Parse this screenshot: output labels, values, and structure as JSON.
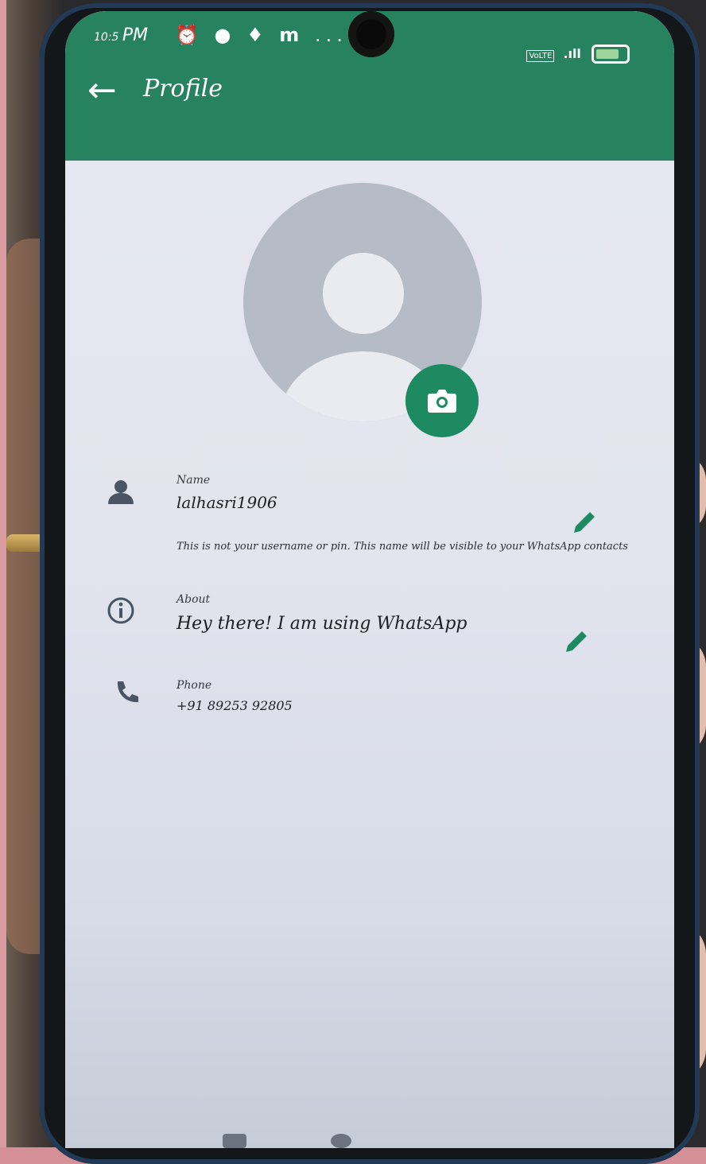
{
  "status_bar": {
    "time_small": "10:5",
    "time_large": "PM",
    "icons": [
      "alarm-icon",
      "chat-icon",
      "swiggy-icon",
      "m-icon",
      "more-dots"
    ],
    "more": "...",
    "network": "VoLTE",
    "signal": ".ıll"
  },
  "app_bar": {
    "title": "Profile"
  },
  "profile": {
    "name_label": "Name",
    "name_value": "lalhasri1906",
    "name_hint": "This is not your username or pin. This name will be visible to your WhatsApp contacts",
    "about_label": "About",
    "about_value": "Hey there! I am using WhatsApp",
    "phone_label": "Phone",
    "phone_value": "+91 89253 92805"
  },
  "colors": {
    "accent": "#278260",
    "fab": "#1e8a62",
    "avatar_bg": "#b6bcc6"
  }
}
